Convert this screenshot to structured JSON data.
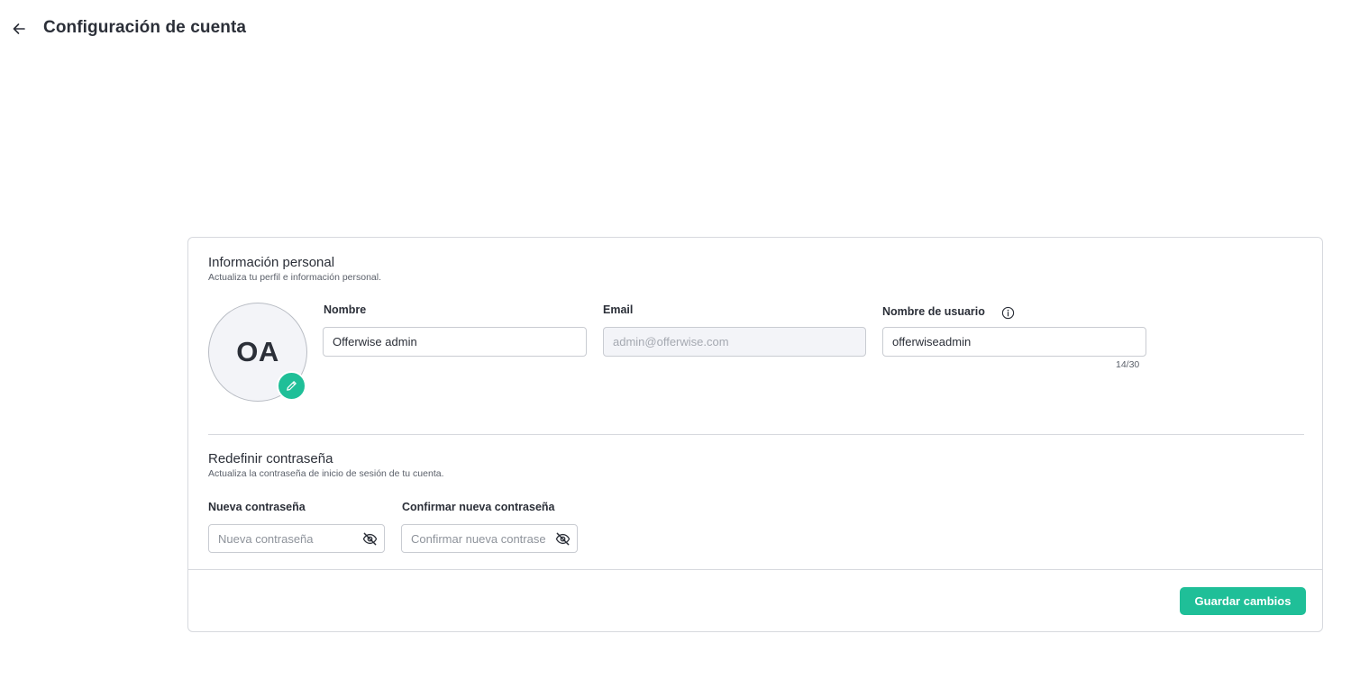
{
  "header": {
    "title": "Configuración de cuenta"
  },
  "personal": {
    "title": "Información personal",
    "subtitle": "Actualiza tu perfil e información personal.",
    "avatar_initials": "OA",
    "name": {
      "label": "Nombre",
      "value": "Offerwise admin"
    },
    "email": {
      "label": "Email",
      "value": "admin@offerwise.com"
    },
    "username": {
      "label": "Nombre de usuario",
      "value": "offerwiseadmin",
      "counter": "14/30"
    }
  },
  "password": {
    "title": "Redefinir contraseña",
    "subtitle": "Actualiza la contraseña de inicio de sesión de tu cuenta.",
    "new": {
      "label": "Nueva contraseña",
      "placeholder": "Nueva contraseña"
    },
    "confirm": {
      "label": "Confirmar nueva contraseña",
      "placeholder": "Confirmar nueva contraseña"
    }
  },
  "actions": {
    "save_label": "Guardar cambios"
  },
  "icons": {
    "back": "arrow-left-icon",
    "edit": "pencil-icon",
    "info": "info-icon",
    "toggle_visibility": "eye-off-icon"
  },
  "colors": {
    "accent": "#1fbf98",
    "text": "#2b2f38",
    "border": "#d7d9de"
  }
}
